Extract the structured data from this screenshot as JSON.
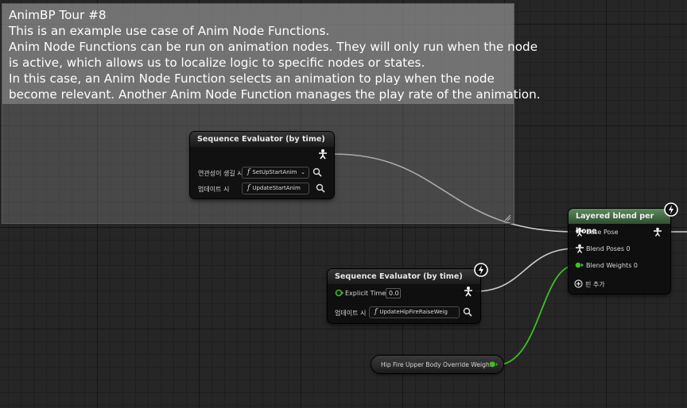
{
  "comment": {
    "title": "AnimBP Tour #8",
    "lines": [
      "This is an example use case of Anim Node Functions.",
      "Anim Node Functions can be run on animation nodes. They will only run when the node",
      "is active, which allows us to localize logic to specific nodes or states.",
      "In this case, an Anim Node Function selects an animation to play when the node",
      "become relevant. Another Anim Node Function manages the play rate of the animation."
    ]
  },
  "node_seq1": {
    "title": "Sequence Evaluator (by time)",
    "row1_label": "연관성이 생길 시",
    "row1_value": "SetUpStartAnim",
    "row2_label": "업데이트 시",
    "row2_value": "UpdateStartAnim"
  },
  "node_seq2": {
    "title": "Sequence Evaluator (by time)",
    "explicit_time_label": "Explicit Time",
    "explicit_time_value": "0.0",
    "row_label": "업데이트 시",
    "row_value": "UpdateHipFireRaiseWeig"
  },
  "node_blend": {
    "title": "Layered blend per bone",
    "base_pose": "Base Pose",
    "blend_poses": "Blend Poses 0",
    "blend_weights": "Blend Weights 0",
    "add_pin": "핀 추가"
  },
  "node_var": {
    "label": "Hip Fire Upper Body Override Weight"
  },
  "colors": {
    "exec_wire": "#cfcfcf",
    "float_wire": "#3fbf1f",
    "blend_header": "#4f7a4e"
  }
}
